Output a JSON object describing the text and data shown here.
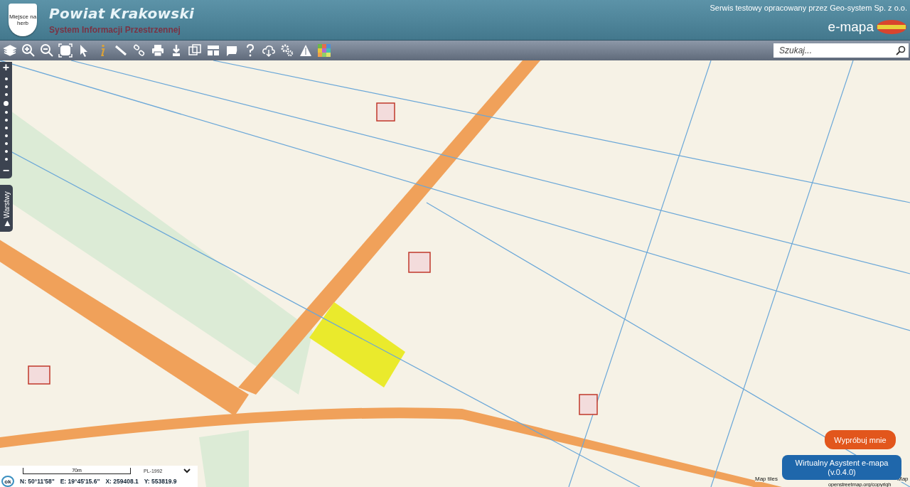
{
  "header": {
    "crest_text": "Miejsce na herb",
    "title": "Powiat Krakowski",
    "subtitle": "System Informacji Przestrzennej",
    "credit": "Serwis testowy opracowany przez Geo-system Sp. z o.o.",
    "brand": "e-mapa"
  },
  "search": {
    "placeholder": "Szukaj..."
  },
  "zoom": {
    "plus": "+",
    "minus": "−"
  },
  "layers_tab": {
    "label": "Warstwy",
    "arrow": "▶"
  },
  "scale": {
    "label": "70m",
    "crs": "PL-1992",
    "ok": "ok",
    "coords": [
      "N: 50°11'58\"",
      "E: 19°45'15.6\"",
      "X: 259408.1",
      "Y: 553819.9"
    ]
  },
  "assistant": {
    "try": "Wypróbuj mnie",
    "name": "Wirtualny Asystent e-mapa",
    "version": "(v.0.4.0)"
  },
  "attribution": [
    "Map tiles",
    "Map",
    "openstreetmap.org/copyrigh"
  ]
}
